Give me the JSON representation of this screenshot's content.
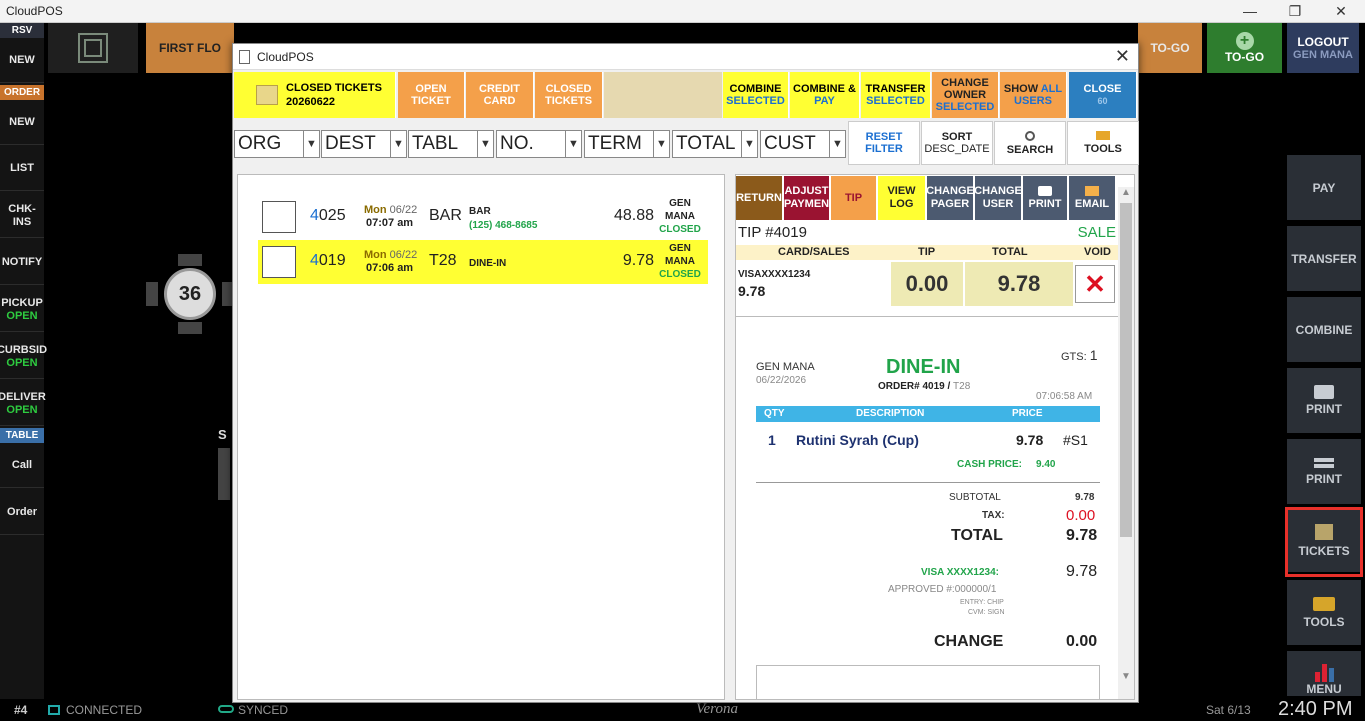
{
  "os": {
    "title": "CloudPOS",
    "min": "—",
    "max": "❐",
    "close": "✕"
  },
  "left_sidebar": {
    "rsv": {
      "label": "RSV",
      "items": [
        "NEW"
      ]
    },
    "order": {
      "label": "ORDER",
      "items": [
        "NEW",
        "LIST",
        "CHK-INS",
        "NOTIFY"
      ]
    },
    "pickup": {
      "label": "PICKUP",
      "sub": "OPEN"
    },
    "curbside": {
      "label": "CURBSID",
      "sub": "OPEN"
    },
    "delivery": {
      "label": "DELIVER",
      "sub": "OPEN"
    },
    "table": {
      "label": "TABLE",
      "items": [
        "Call",
        "Order"
      ]
    }
  },
  "topbar": {
    "floor": "FIRST FLO",
    "togo": "TO-GO",
    "togo_add": "TO-GO",
    "logout": "LOGOUT",
    "logout_user": "GEN MANA"
  },
  "right_sidebar": [
    "PAY",
    "TRANSFER",
    "COMBINE",
    "PRINT",
    "PRINT",
    "TICKETS",
    "TOOLS",
    "MENU"
  ],
  "floor": {
    "table_number": "36",
    "partial_label": "S"
  },
  "dialog": {
    "title": "CloudPOS",
    "close": "✕",
    "toolbar": {
      "closed_tickets": "CLOSED TICKETS",
      "closed_date": "20260622",
      "open_ticket": [
        "OPEN",
        "TICKET"
      ],
      "credit_card": [
        "CREDIT",
        "CARD"
      ],
      "closed_tickets_btn": [
        "CLOSED",
        "TICKETS"
      ],
      "combine_selected": [
        "COMBINE",
        "SELECTED"
      ],
      "combine_pay": [
        "COMBINE &",
        "PAY"
      ],
      "transfer_selected": [
        "TRANSFER",
        "SELECTED"
      ],
      "change_owner": [
        "CHANGE",
        "OWNER",
        "SELECTED"
      ],
      "show_all_users": [
        "SHOW ",
        "ALL",
        "USERS"
      ],
      "close": [
        "CLOSE",
        "60"
      ]
    },
    "filters": [
      "ORG",
      "DEST",
      "TABL",
      "NO.",
      "TERM",
      "TOTAL",
      "CUST"
    ],
    "filter_buttons": {
      "reset": [
        "RESET",
        "FILTER"
      ],
      "sort": [
        "SORT",
        "DESC_DATE"
      ],
      "search": "SEARCH",
      "tools": "TOOLS"
    },
    "tickets": [
      {
        "num_prefix": "4",
        "num_rest": "025",
        "day": "Mon",
        "date": "06/22",
        "time": "07:07 am",
        "table": "BAR",
        "dest": "BAR",
        "phone": "(125) 468-8685",
        "amount": "48.88",
        "user": [
          "GEN",
          "MANA"
        ],
        "status": "CLOSED",
        "selected": false
      },
      {
        "num_prefix": "4",
        "num_rest": "019",
        "day": "Mon",
        "date": "06/22",
        "time": "07:06 am",
        "table": "T28",
        "dest": "DINE-IN",
        "phone": "",
        "amount": "9.78",
        "user": [
          "GEN",
          "MANA"
        ],
        "status": "CLOSED",
        "selected": true
      }
    ],
    "actions": {
      "return": "RETURN",
      "adjust": [
        "ADJUST",
        "PAYMEN"
      ],
      "tip": "TIP",
      "view_log": [
        "VIEW",
        "LOG"
      ],
      "change_pager": [
        "CHANGE",
        "PAGER"
      ],
      "change_user": [
        "CHANGE",
        "USER"
      ],
      "print": "PRINT",
      "email": "EMAIL"
    },
    "payment": {
      "tip_label": "TIP #4019",
      "status": "SALE",
      "headers": [
        "CARD/SALES",
        "TIP",
        "TOTAL",
        "VOID"
      ],
      "card": "VISAXXXX1234",
      "card_amount": "9.78",
      "tip": "0.00",
      "total": "9.78"
    },
    "receipt": {
      "server": "GEN MANA",
      "date": "06/22/2026",
      "type": "DINE-IN",
      "order_label": "ORDER# 4019",
      "order_table": "T28",
      "gts_label": "GTS:",
      "gts": "1",
      "time": "07:06:58 AM",
      "columns": [
        "QTY",
        "DESCRIPTION",
        "PRICE"
      ],
      "item": {
        "qty": "1",
        "desc": "Rutini Syrah (Cup)",
        "price": "9.78",
        "code": "#S1"
      },
      "cash_price_label": "CASH PRICE:",
      "cash_price": "9.40",
      "subtotal_label": "SUBTOTAL",
      "subtotal": "9.78",
      "tax_label": "TAX:",
      "tax": "0.00",
      "total_label": "TOTAL",
      "total": "9.78",
      "visa_label": "VISA XXXX1234:",
      "visa": "9.78",
      "approved": "APPROVED #:000000/1",
      "entry": "ENTRY: CHIP",
      "cvm": "CVM: SIGN",
      "change_label": "CHANGE",
      "change": "0.00"
    }
  },
  "status_bar": {
    "station": "#4",
    "connected": "CONNECTED",
    "synced": "SYNCED",
    "brand": "Verona",
    "date": "Sat 6/13",
    "time": "2:40 PM"
  },
  "colors": {
    "highlight": "#e8302a",
    "green": "#21a44a",
    "yellow": "#ffff33",
    "orange": "#f4a04a"
  }
}
